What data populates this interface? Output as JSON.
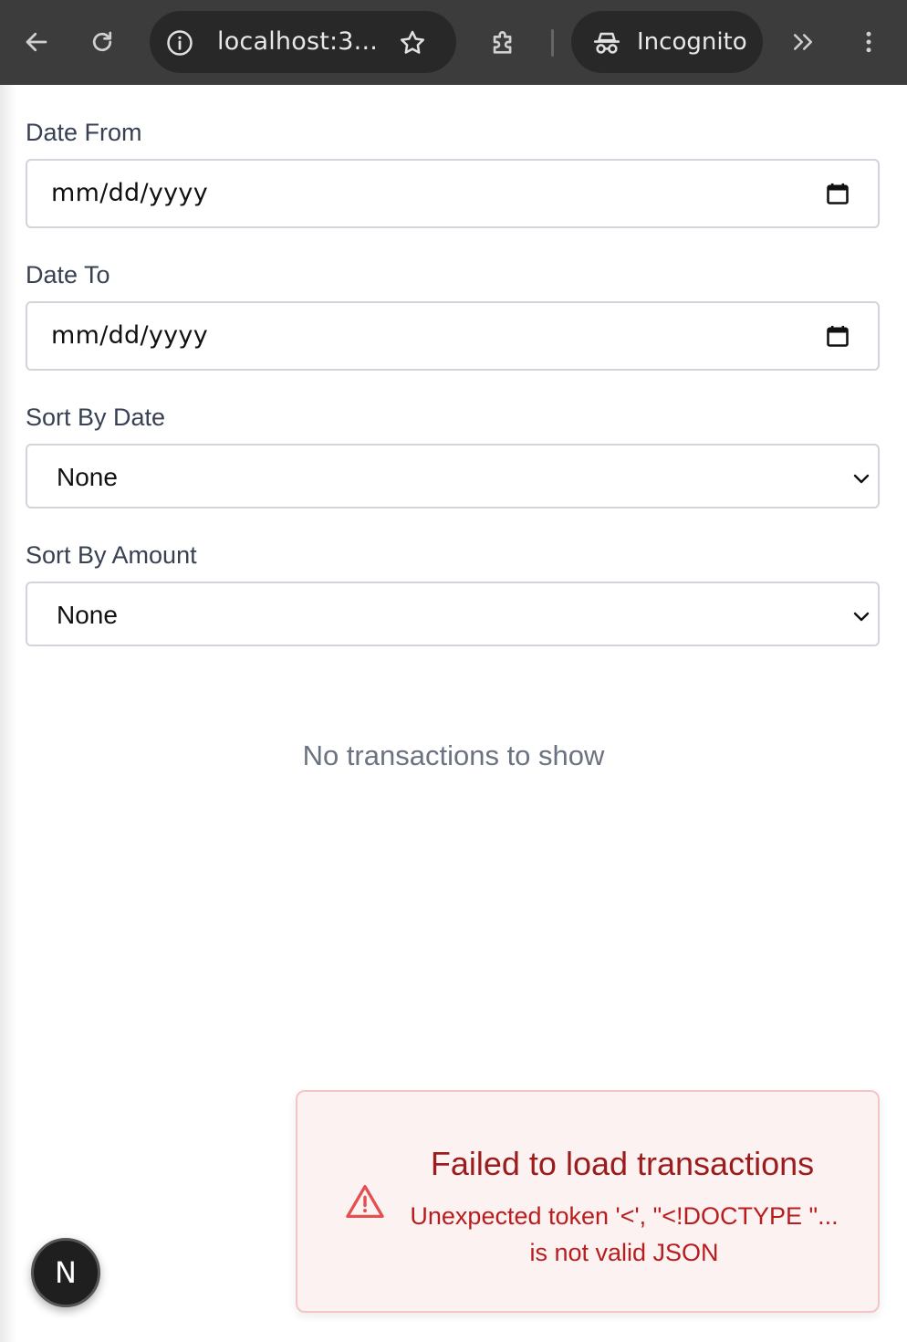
{
  "browser": {
    "url": "localhost:3...",
    "incognito_label": "Incognito"
  },
  "filters": {
    "date_from": {
      "label": "Date From",
      "placeholder": "mm/dd/yyyy"
    },
    "date_to": {
      "label": "Date To",
      "placeholder": "mm/dd/yyyy"
    },
    "sort_by_date": {
      "label": "Sort By Date",
      "value": "None"
    },
    "sort_by_amount": {
      "label": "Sort By Amount",
      "value": "None"
    }
  },
  "empty_state": "No transactions to show",
  "toast": {
    "title": "Failed to load transactions",
    "message": "Unexpected token '<', \"<!DOCTYPE \"... is not valid JSON",
    "icon": "warning-triangle-icon",
    "color": "#9b1c1c"
  },
  "dev_badge": {
    "letter": "N"
  }
}
